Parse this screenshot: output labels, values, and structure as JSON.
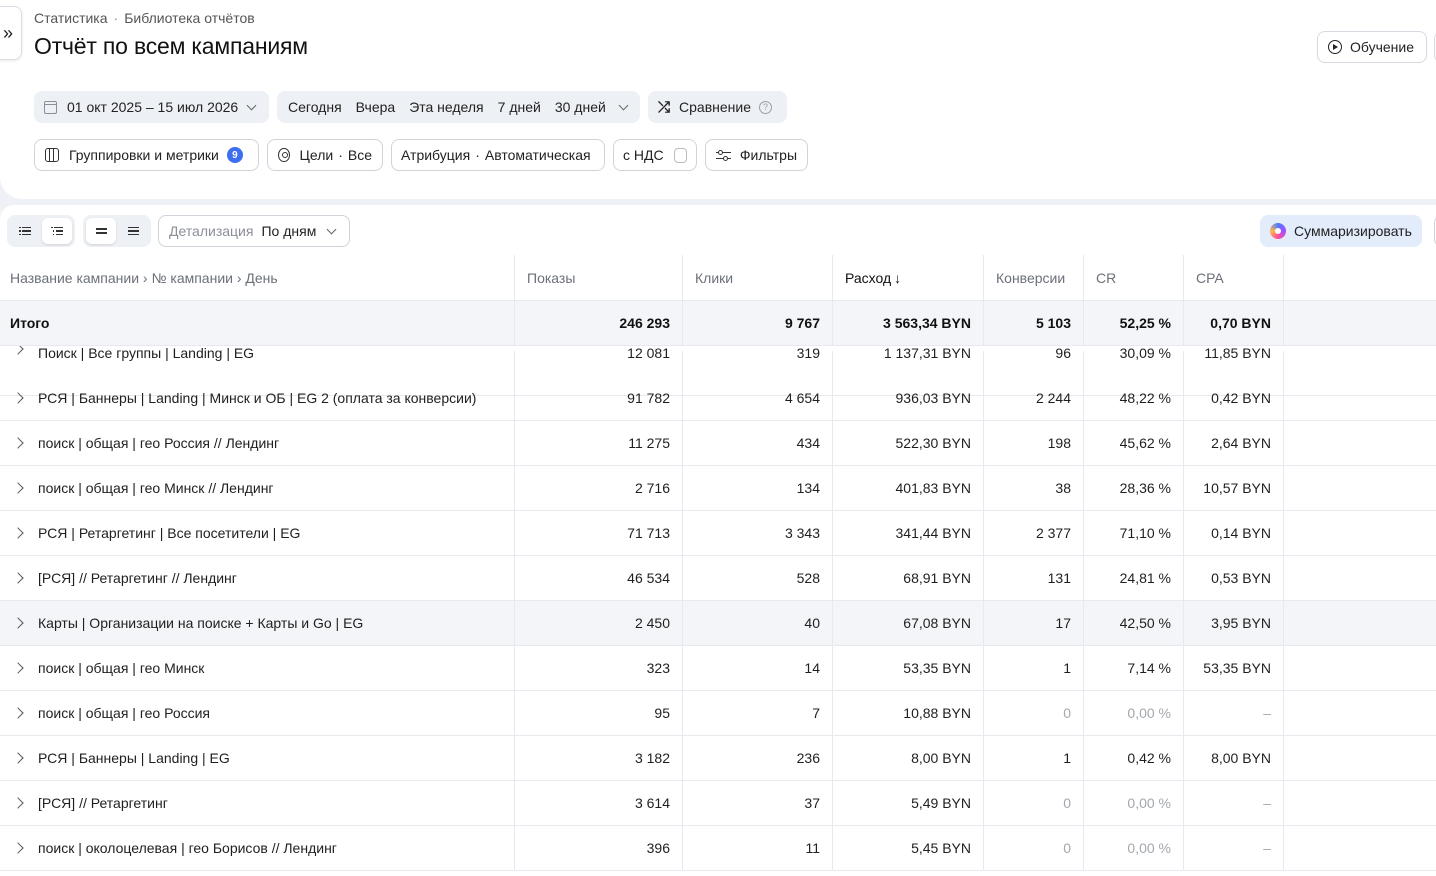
{
  "breadcrumb": {
    "root": "Статистика",
    "current": "Библиотека отчётов"
  },
  "page_title": "Отчёт по всем кампаниям",
  "learn_button": "Обучение",
  "date_range": "01 окт 2025 – 15 июл 2026",
  "presets": [
    "Сегодня",
    "Вчера",
    "Эта неделя",
    "7 дней",
    "30 дней"
  ],
  "compare": "Сравнение",
  "groupings": {
    "label": "Группировки и метрики",
    "count": "9"
  },
  "goals": {
    "label": "Цели",
    "value": "Все"
  },
  "attribution": {
    "label": "Атрибуция",
    "value": "Автоматическая"
  },
  "vat": "с НДС",
  "filters": "Фильтры",
  "detail": {
    "label": "Детализация",
    "value": "По дням"
  },
  "summarize": "Суммаризировать",
  "table": {
    "headers": [
      "Название кампании › № кампании › День",
      "Показы",
      "Клики",
      "Расход",
      "Конверсии",
      "CR",
      "CPA"
    ],
    "sorted_column": "Расход",
    "total": [
      "Итого",
      "246 293",
      "9 767",
      "3 563,34 BYN",
      "5 103",
      "52,25 %",
      "0,70 BYN"
    ],
    "partial_row": [
      "Поиск | Все группы | Landing | EG",
      "12 081",
      "319",
      "1 137,31 BYN",
      "96",
      "30,09 %",
      "11,85 BYN"
    ],
    "rows": [
      [
        "РСЯ | Баннеры | Landing | Минск и ОБ | EG 2 (оплата за конверсии)",
        "91 782",
        "4 654",
        "936,03 BYN",
        "2 244",
        "48,22 %",
        "0,42 BYN"
      ],
      [
        "поиск | общая | гео Россия // Лендинг",
        "11 275",
        "434",
        "522,30 BYN",
        "198",
        "45,62 %",
        "2,64 BYN"
      ],
      [
        "поиск | общая | гео Минск // Лендинг",
        "2 716",
        "134",
        "401,83 BYN",
        "38",
        "28,36 %",
        "10,57 BYN"
      ],
      [
        "РСЯ | Ретаргетинг | Все посетители | EG",
        "71 713",
        "3 343",
        "341,44 BYN",
        "2 377",
        "71,10 %",
        "0,14 BYN"
      ],
      [
        "[РСЯ] // Ретаргетинг // Лендинг",
        "46 534",
        "528",
        "68,91 BYN",
        "131",
        "24,81 %",
        "0,53 BYN"
      ],
      [
        "Карты | Организации на поиске + Карты и Go | EG",
        "2 450",
        "40",
        "67,08 BYN",
        "17",
        "42,50 %",
        "3,95 BYN"
      ],
      [
        "поиск | общая | гео Минск",
        "323",
        "14",
        "53,35 BYN",
        "1",
        "7,14 %",
        "53,35 BYN"
      ],
      [
        "поиск | общая | гео Россия",
        "95",
        "7",
        "10,88 BYN",
        "0",
        "0,00 %",
        "–"
      ],
      [
        "РСЯ | Баннеры | Landing | EG",
        "3 182",
        "236",
        "8,00 BYN",
        "1",
        "0,42 %",
        "8,00 BYN"
      ],
      [
        "[РСЯ] // Ретаргетинг",
        "3 614",
        "37",
        "5,49 BYN",
        "0",
        "0,00 %",
        "–"
      ],
      [
        "поиск | околоцелевая | гео Борисов // Лендинг",
        "396",
        "11",
        "5,45 BYN",
        "0",
        "0,00 %",
        "–"
      ]
    ]
  },
  "colors": {
    "accent": "#3d6df0",
    "muted": "#a3a8af",
    "summarize_bg": "#e3ecfb"
  }
}
